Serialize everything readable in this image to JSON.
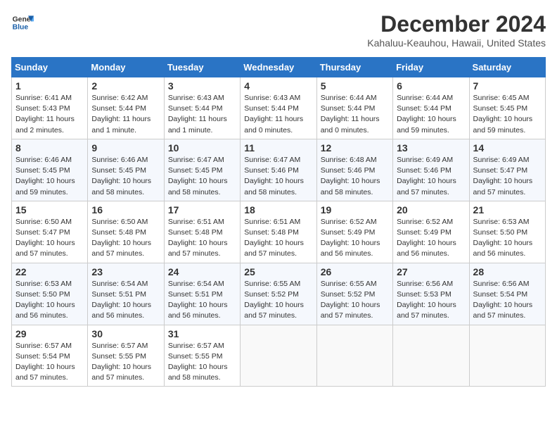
{
  "logo": {
    "general": "General",
    "blue": "Blue"
  },
  "title": "December 2024",
  "subtitle": "Kahaluu-Keauhou, Hawaii, United States",
  "days_of_week": [
    "Sunday",
    "Monday",
    "Tuesday",
    "Wednesday",
    "Thursday",
    "Friday",
    "Saturday"
  ],
  "weeks": [
    [
      {
        "day": 1,
        "lines": [
          "Sunrise: 6:41 AM",
          "Sunset: 5:43 PM",
          "Daylight: 11 hours",
          "and 2 minutes."
        ]
      },
      {
        "day": 2,
        "lines": [
          "Sunrise: 6:42 AM",
          "Sunset: 5:44 PM",
          "Daylight: 11 hours",
          "and 1 minute."
        ]
      },
      {
        "day": 3,
        "lines": [
          "Sunrise: 6:43 AM",
          "Sunset: 5:44 PM",
          "Daylight: 11 hours",
          "and 1 minute."
        ]
      },
      {
        "day": 4,
        "lines": [
          "Sunrise: 6:43 AM",
          "Sunset: 5:44 PM",
          "Daylight: 11 hours",
          "and 0 minutes."
        ]
      },
      {
        "day": 5,
        "lines": [
          "Sunrise: 6:44 AM",
          "Sunset: 5:44 PM",
          "Daylight: 11 hours",
          "and 0 minutes."
        ]
      },
      {
        "day": 6,
        "lines": [
          "Sunrise: 6:44 AM",
          "Sunset: 5:44 PM",
          "Daylight: 10 hours",
          "and 59 minutes."
        ]
      },
      {
        "day": 7,
        "lines": [
          "Sunrise: 6:45 AM",
          "Sunset: 5:45 PM",
          "Daylight: 10 hours",
          "and 59 minutes."
        ]
      }
    ],
    [
      {
        "day": 8,
        "lines": [
          "Sunrise: 6:46 AM",
          "Sunset: 5:45 PM",
          "Daylight: 10 hours",
          "and 59 minutes."
        ]
      },
      {
        "day": 9,
        "lines": [
          "Sunrise: 6:46 AM",
          "Sunset: 5:45 PM",
          "Daylight: 10 hours",
          "and 58 minutes."
        ]
      },
      {
        "day": 10,
        "lines": [
          "Sunrise: 6:47 AM",
          "Sunset: 5:45 PM",
          "Daylight: 10 hours",
          "and 58 minutes."
        ]
      },
      {
        "day": 11,
        "lines": [
          "Sunrise: 6:47 AM",
          "Sunset: 5:46 PM",
          "Daylight: 10 hours",
          "and 58 minutes."
        ]
      },
      {
        "day": 12,
        "lines": [
          "Sunrise: 6:48 AM",
          "Sunset: 5:46 PM",
          "Daylight: 10 hours",
          "and 58 minutes."
        ]
      },
      {
        "day": 13,
        "lines": [
          "Sunrise: 6:49 AM",
          "Sunset: 5:46 PM",
          "Daylight: 10 hours",
          "and 57 minutes."
        ]
      },
      {
        "day": 14,
        "lines": [
          "Sunrise: 6:49 AM",
          "Sunset: 5:47 PM",
          "Daylight: 10 hours",
          "and 57 minutes."
        ]
      }
    ],
    [
      {
        "day": 15,
        "lines": [
          "Sunrise: 6:50 AM",
          "Sunset: 5:47 PM",
          "Daylight: 10 hours",
          "and 57 minutes."
        ]
      },
      {
        "day": 16,
        "lines": [
          "Sunrise: 6:50 AM",
          "Sunset: 5:48 PM",
          "Daylight: 10 hours",
          "and 57 minutes."
        ]
      },
      {
        "day": 17,
        "lines": [
          "Sunrise: 6:51 AM",
          "Sunset: 5:48 PM",
          "Daylight: 10 hours",
          "and 57 minutes."
        ]
      },
      {
        "day": 18,
        "lines": [
          "Sunrise: 6:51 AM",
          "Sunset: 5:48 PM",
          "Daylight: 10 hours",
          "and 57 minutes."
        ]
      },
      {
        "day": 19,
        "lines": [
          "Sunrise: 6:52 AM",
          "Sunset: 5:49 PM",
          "Daylight: 10 hours",
          "and 56 minutes."
        ]
      },
      {
        "day": 20,
        "lines": [
          "Sunrise: 6:52 AM",
          "Sunset: 5:49 PM",
          "Daylight: 10 hours",
          "and 56 minutes."
        ]
      },
      {
        "day": 21,
        "lines": [
          "Sunrise: 6:53 AM",
          "Sunset: 5:50 PM",
          "Daylight: 10 hours",
          "and 56 minutes."
        ]
      }
    ],
    [
      {
        "day": 22,
        "lines": [
          "Sunrise: 6:53 AM",
          "Sunset: 5:50 PM",
          "Daylight: 10 hours",
          "and 56 minutes."
        ]
      },
      {
        "day": 23,
        "lines": [
          "Sunrise: 6:54 AM",
          "Sunset: 5:51 PM",
          "Daylight: 10 hours",
          "and 56 minutes."
        ]
      },
      {
        "day": 24,
        "lines": [
          "Sunrise: 6:54 AM",
          "Sunset: 5:51 PM",
          "Daylight: 10 hours",
          "and 56 minutes."
        ]
      },
      {
        "day": 25,
        "lines": [
          "Sunrise: 6:55 AM",
          "Sunset: 5:52 PM",
          "Daylight: 10 hours",
          "and 57 minutes."
        ]
      },
      {
        "day": 26,
        "lines": [
          "Sunrise: 6:55 AM",
          "Sunset: 5:52 PM",
          "Daylight: 10 hours",
          "and 57 minutes."
        ]
      },
      {
        "day": 27,
        "lines": [
          "Sunrise: 6:56 AM",
          "Sunset: 5:53 PM",
          "Daylight: 10 hours",
          "and 57 minutes."
        ]
      },
      {
        "day": 28,
        "lines": [
          "Sunrise: 6:56 AM",
          "Sunset: 5:54 PM",
          "Daylight: 10 hours",
          "and 57 minutes."
        ]
      }
    ],
    [
      {
        "day": 29,
        "lines": [
          "Sunrise: 6:57 AM",
          "Sunset: 5:54 PM",
          "Daylight: 10 hours",
          "and 57 minutes."
        ]
      },
      {
        "day": 30,
        "lines": [
          "Sunrise: 6:57 AM",
          "Sunset: 5:55 PM",
          "Daylight: 10 hours",
          "and 57 minutes."
        ]
      },
      {
        "day": 31,
        "lines": [
          "Sunrise: 6:57 AM",
          "Sunset: 5:55 PM",
          "Daylight: 10 hours",
          "and 58 minutes."
        ]
      },
      null,
      null,
      null,
      null
    ]
  ]
}
